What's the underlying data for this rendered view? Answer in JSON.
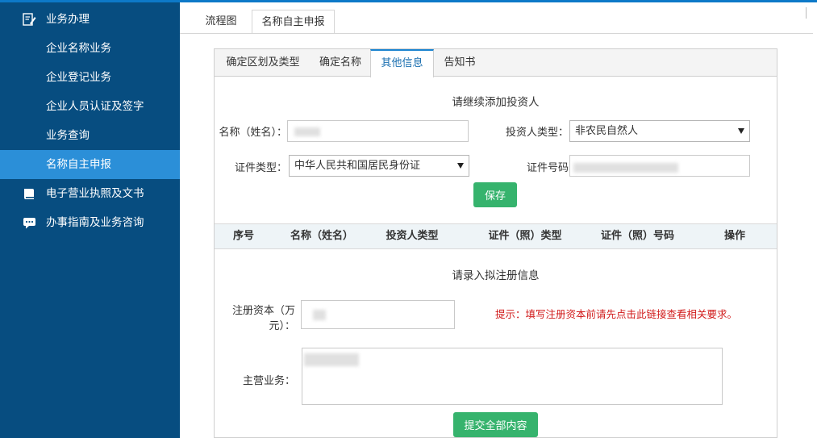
{
  "sidebar": {
    "items": [
      {
        "label": "业务办理",
        "icon": "edit-icon"
      },
      {
        "label": "企业名称业务"
      },
      {
        "label": "企业登记业务"
      },
      {
        "label": "企业人员认证及签字"
      },
      {
        "label": "业务查询"
      },
      {
        "label": "名称自主申报"
      },
      {
        "label": "电子营业执照及文书",
        "icon": "book-icon"
      },
      {
        "label": "办事指南及业务咨询",
        "icon": "chat-icon"
      }
    ]
  },
  "outer_tabs": [
    {
      "label": "流程图"
    },
    {
      "label": "名称自主申报"
    }
  ],
  "inner_tabs": [
    {
      "label": "确定区划及类型"
    },
    {
      "label": "确定名称"
    },
    {
      "label": "其他信息"
    },
    {
      "label": "告知书"
    }
  ],
  "investor": {
    "title": "请继续添加投资人",
    "name_label": "名称（姓名）：",
    "type_label": "投资人类型：",
    "type_value": "非农民自然人",
    "cert_type_label": "证件类型：",
    "cert_type_value": "中华人民共和国居民身份证",
    "cert_no_label": "证件号码",
    "save_label": "保存"
  },
  "table": {
    "headers": [
      "序号",
      "名称（姓名）",
      "投资人类型",
      "证件（照）类型",
      "证件（照）号码",
      "操作"
    ]
  },
  "registration": {
    "title": "请录入拟注册信息",
    "capital_label_1": "注册资本（万",
    "capital_label_2": "元）：",
    "hint": "提示：填写注册资本前请先点击此链接查看相关要求。",
    "business_label": "主营业务：",
    "submit_label": "提交全部内容"
  },
  "colors": {
    "sidebar_bg": "#074d80",
    "sidebar_active": "#2b8fd8",
    "accent_green": "#36b36d",
    "hint_red": "#d11a1a"
  }
}
